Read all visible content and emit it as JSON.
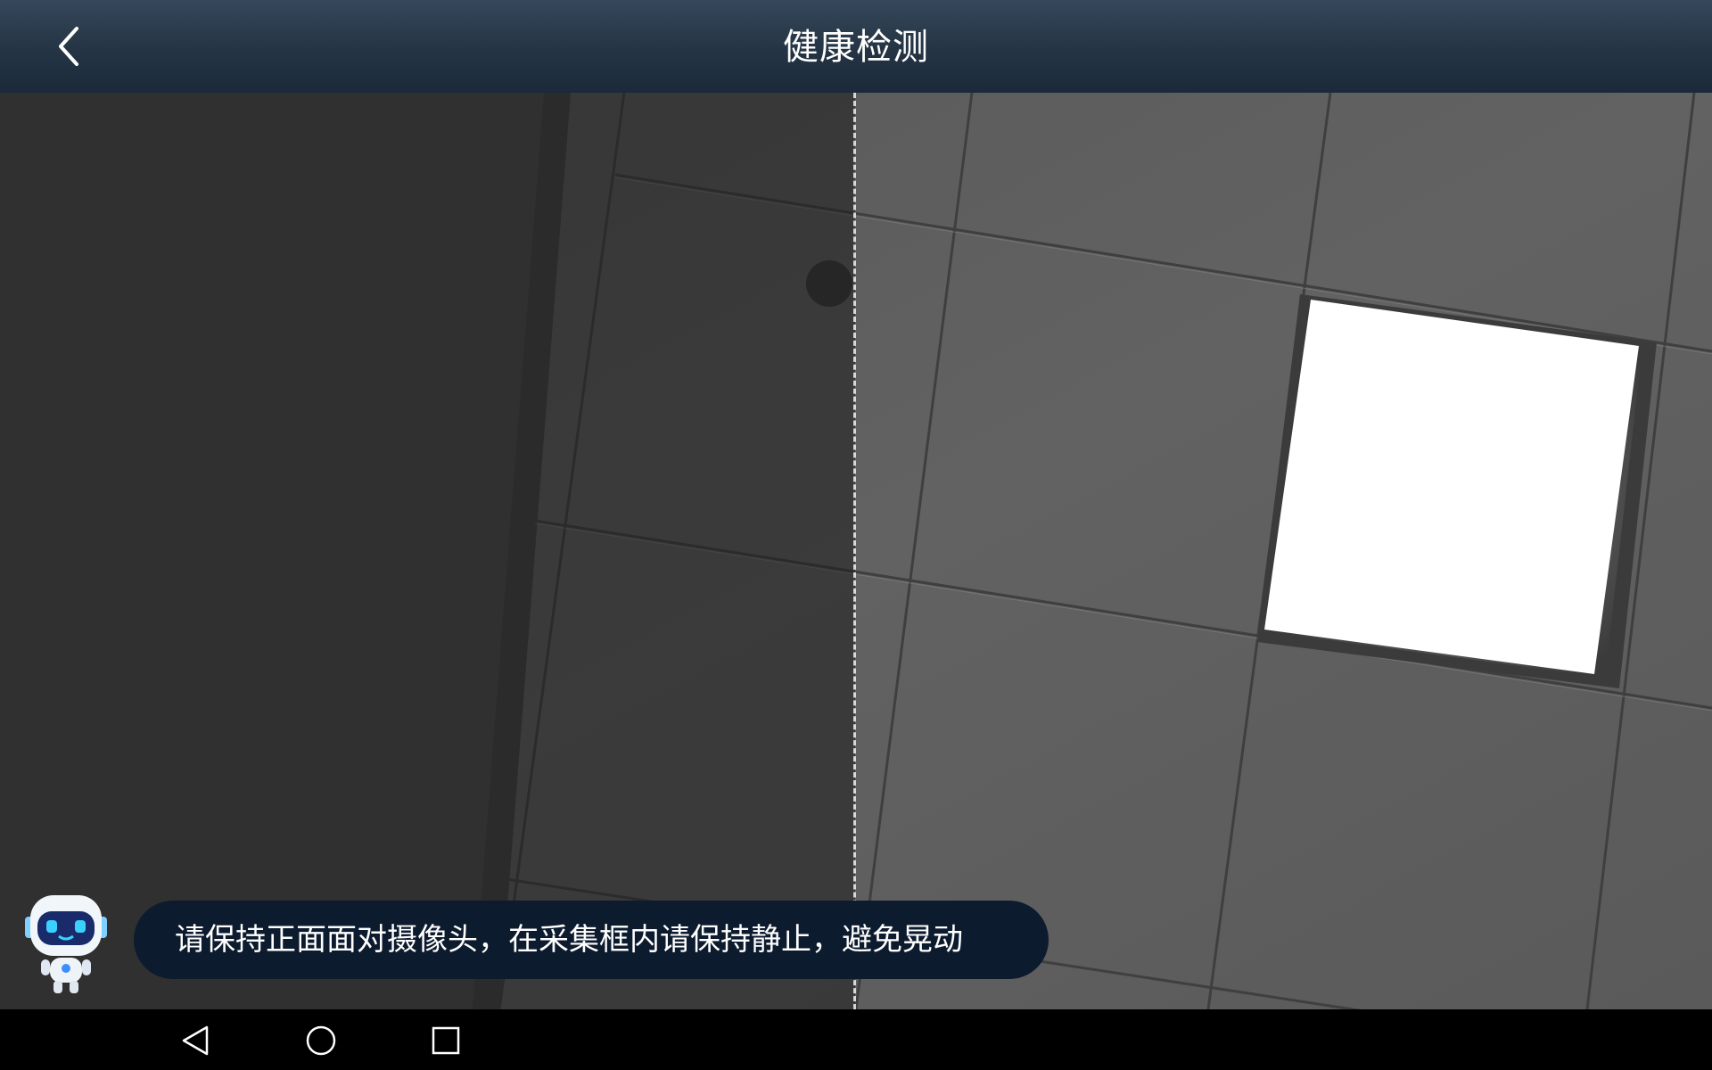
{
  "header": {
    "title": "健康检测",
    "back_icon": "chevron-left-icon"
  },
  "camera": {
    "capture_guide": "dashed-vertical-line"
  },
  "assistant": {
    "icon": "robot-mascot-icon",
    "tip": "请保持正面面对摄像头，在采集框内请保持静止，避免晃动"
  },
  "navbar": {
    "back_icon": "triangle-back-icon",
    "home_icon": "circle-home-icon",
    "recents_icon": "square-recents-icon"
  },
  "colors": {
    "header_bg": "#243444",
    "bubble_bg": "#0d1b2e",
    "text": "#ffffff",
    "navbar_bg": "#000000"
  }
}
